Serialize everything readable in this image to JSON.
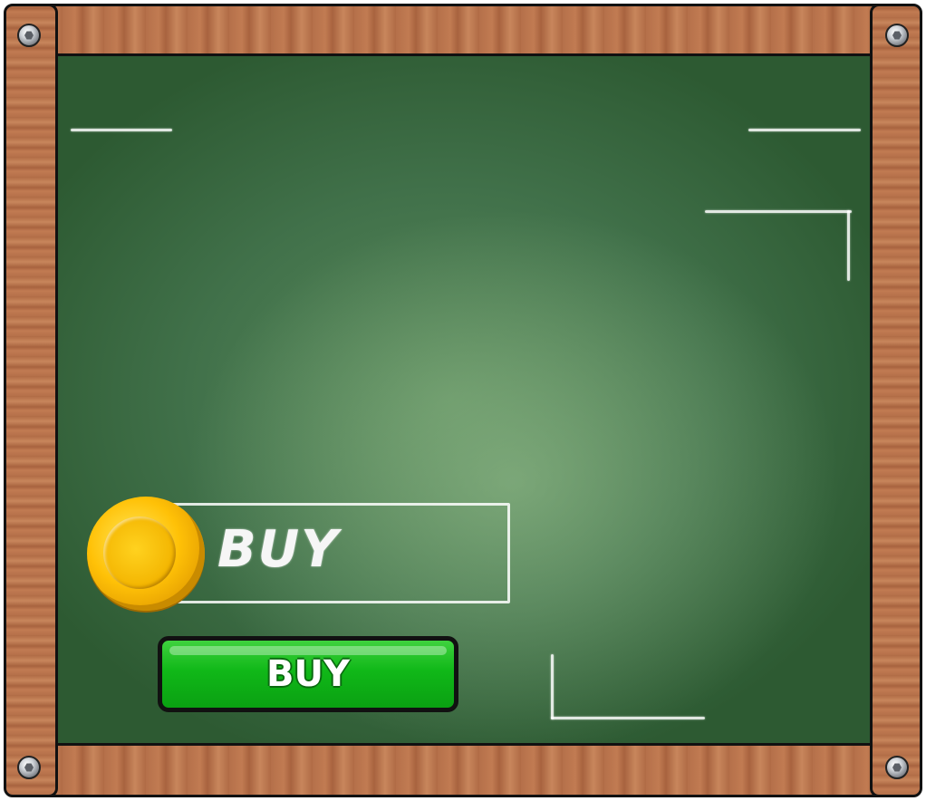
{
  "panel": {
    "chalk_label": "BUY",
    "buy_button_label": "BUY"
  },
  "colors": {
    "board": "#41714a",
    "wood": "#b5704a",
    "button": "#10b818",
    "coin": "#ffc107"
  },
  "icons": {
    "coin": "gold-coin-icon",
    "bolt": "hex-bolt-icon"
  }
}
